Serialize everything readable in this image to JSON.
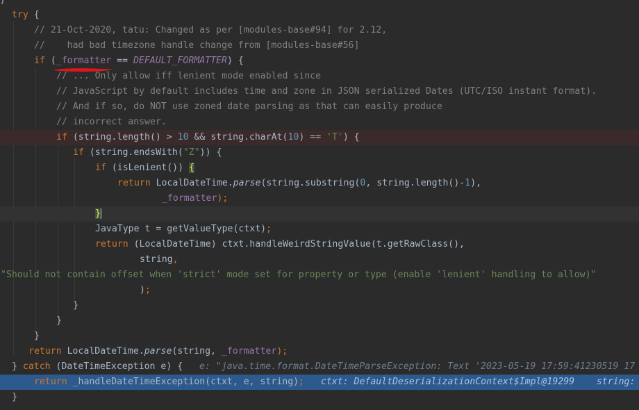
{
  "code_lines": [
    {
      "indent": 0,
      "tokens": [
        {
          "t": "}",
          "c": "pl"
        }
      ]
    },
    {
      "indent": 17,
      "tokens": [
        {
          "t": "try",
          "c": "kw"
        },
        {
          "t": " {",
          "c": "pl"
        }
      ]
    },
    {
      "indent": 49,
      "tokens": [
        {
          "t": "// 21-Oct-2020, tatu: Changed as per [modules-base#94] for 2.12,",
          "c": "cm"
        }
      ]
    },
    {
      "indent": 49,
      "tokens": [
        {
          "t": "//    had bad timezone handle change from [modules-base#56]",
          "c": "cm"
        }
      ]
    },
    {
      "indent": 49,
      "tokens": [
        {
          "t": "if",
          "c": "kw"
        },
        {
          "t": " (",
          "c": "pl"
        },
        {
          "t": "_formatter",
          "c": "fld"
        },
        {
          "t": " == ",
          "c": "pl"
        },
        {
          "t": "DEFAULT_FORMATTER",
          "c": "cst"
        },
        {
          "t": ") {",
          "c": "pl"
        }
      ]
    },
    {
      "indent": 81,
      "tokens": [
        {
          "t": "// ... Only allow iff lenient mode enabled since",
          "c": "cm"
        }
      ]
    },
    {
      "indent": 81,
      "tokens": [
        {
          "t": "// JavaScript by default includes time and zone in JSON serialized Dates (UTC/ISO instant format).",
          "c": "cm"
        }
      ]
    },
    {
      "indent": 81,
      "tokens": [
        {
          "t": "// And if so, do NOT use zoned date parsing as that can easily produce",
          "c": "cm"
        }
      ]
    },
    {
      "indent": 81,
      "tokens": [
        {
          "t": "// incorrect answer.",
          "c": "cm"
        }
      ]
    },
    {
      "indent": 81,
      "hl": "red",
      "tokens": [
        {
          "t": "if",
          "c": "kw"
        },
        {
          "t": " (string.length() > ",
          "c": "pl"
        },
        {
          "t": "10",
          "c": "num"
        },
        {
          "t": " && string.charAt(",
          "c": "pl"
        },
        {
          "t": "10",
          "c": "num"
        },
        {
          "t": ") == ",
          "c": "pl"
        },
        {
          "t": "'T'",
          "c": "str"
        },
        {
          "t": ") {",
          "c": "pl"
        }
      ]
    },
    {
      "indent": 105,
      "tokens": [
        {
          "t": "if",
          "c": "kw"
        },
        {
          "t": " (string.endsWith(",
          "c": "pl"
        },
        {
          "t": "\"Z\"",
          "c": "str"
        },
        {
          "t": ")) {",
          "c": "pl"
        }
      ]
    },
    {
      "indent": 137,
      "tokens": [
        {
          "t": "if",
          "c": "kw"
        },
        {
          "t": " (isLenient()) ",
          "c": "pl"
        },
        {
          "t": "{",
          "c": "brace-hl"
        }
      ]
    },
    {
      "indent": 169,
      "tokens": [
        {
          "t": "return",
          "c": "kw"
        },
        {
          "t": " LocalDateTime.",
          "c": "pl"
        },
        {
          "t": "parse",
          "c": "pl it"
        },
        {
          "t": "(string.substring(",
          "c": "pl"
        },
        {
          "t": "0",
          "c": "num"
        },
        {
          "t": ", string.length()-",
          "c": "pl"
        },
        {
          "t": "1",
          "c": "num"
        },
        {
          "t": "),",
          "c": "pl"
        }
      ]
    },
    {
      "indent": 233,
      "tokens": [
        {
          "t": "_formatter",
          "c": "fld"
        },
        {
          "t": ");",
          "c": "kw"
        }
      ]
    },
    {
      "indent": 137,
      "hl": "cur",
      "tokens": [
        {
          "t": "}",
          "c": "brace-hl"
        },
        {
          "t": "",
          "c": "caret"
        }
      ]
    },
    {
      "indent": 137,
      "tokens": [
        {
          "t": "JavaType t = getValueType(ctxt)",
          "c": "pl"
        },
        {
          "t": ";",
          "c": "kw"
        }
      ]
    },
    {
      "indent": 137,
      "tokens": [
        {
          "t": "return",
          "c": "kw"
        },
        {
          "t": " (LocalDateTime) ctxt.handleWeirdStringValue(t.getRawClass(),",
          "c": "pl"
        }
      ]
    },
    {
      "indent": 201,
      "tokens": [
        {
          "t": "string",
          "c": "pl"
        },
        {
          "t": ",",
          "c": "kw"
        }
      ]
    },
    {
      "indent": 1,
      "tokens": [
        {
          "t": "\"Should not contain offset when 'strict' mode set for property or type (enable 'lenient' handling to allow)\"",
          "c": "str"
        }
      ]
    },
    {
      "indent": 201,
      "tokens": [
        {
          "t": ")",
          "c": "pl"
        },
        {
          "t": ";",
          "c": "kw"
        }
      ]
    },
    {
      "indent": 105,
      "tokens": [
        {
          "t": "}",
          "c": "pl"
        }
      ]
    },
    {
      "indent": 81,
      "tokens": [
        {
          "t": "}",
          "c": "pl"
        }
      ]
    },
    {
      "indent": 49,
      "tokens": [
        {
          "t": "}",
          "c": "pl"
        }
      ]
    },
    {
      "indent": 41,
      "tokens": [
        {
          "t": "return",
          "c": "kw"
        },
        {
          "t": " LocalDateTime.",
          "c": "pl"
        },
        {
          "t": "parse",
          "c": "pl it"
        },
        {
          "t": "(string, ",
          "c": "pl"
        },
        {
          "t": "_formatter",
          "c": "fld"
        },
        {
          "t": ");",
          "c": "kw"
        }
      ]
    },
    {
      "indent": 17,
      "tokens": [
        {
          "t": "} ",
          "c": "pl"
        },
        {
          "t": "catch",
          "c": "kw"
        },
        {
          "t": " (DateTimeException e) {   ",
          "c": "pl"
        },
        {
          "t": "e: \"java.time.format.DateTimeParseException: Text '2023-05-19 17:59:41230519 17",
          "c": "hint"
        }
      ]
    },
    {
      "indent": 49,
      "hl": "exec",
      "tokens": [
        {
          "t": "return",
          "c": "kw"
        },
        {
          "t": " _handleDateTimeException(ctxt, e, string)",
          "c": "pl"
        },
        {
          "t": ";",
          "c": "kw"
        },
        {
          "t": "   ctxt: DefaultDeserializationContext$Impl@19299    string:",
          "c": "hint-exec"
        }
      ]
    },
    {
      "indent": 17,
      "tokens": [
        {
          "t": "}",
          "c": "pl"
        }
      ]
    }
  ],
  "colors": {
    "background": "#2b2b2b",
    "keyword": "#cc7832",
    "comment": "#808080",
    "field": "#9876aa",
    "number": "#6897bb",
    "string": "#6a8759",
    "execution_line": "#2d5a8e",
    "annotation_mark": "#e0161c"
  },
  "annotations": [
    "red-underline-marker"
  ]
}
